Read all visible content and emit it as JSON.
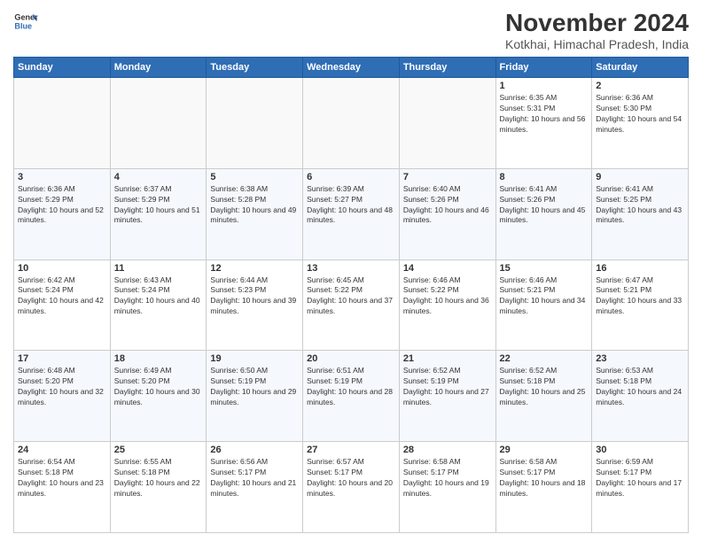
{
  "header": {
    "logo_line1": "General",
    "logo_line2": "Blue",
    "month_title": "November 2024",
    "subtitle": "Kotkhai, Himachal Pradesh, India"
  },
  "weekdays": [
    "Sunday",
    "Monday",
    "Tuesday",
    "Wednesday",
    "Thursday",
    "Friday",
    "Saturday"
  ],
  "weeks": [
    [
      {
        "day": "",
        "info": ""
      },
      {
        "day": "",
        "info": ""
      },
      {
        "day": "",
        "info": ""
      },
      {
        "day": "",
        "info": ""
      },
      {
        "day": "",
        "info": ""
      },
      {
        "day": "1",
        "info": "Sunrise: 6:35 AM\nSunset: 5:31 PM\nDaylight: 10 hours and 56 minutes."
      },
      {
        "day": "2",
        "info": "Sunrise: 6:36 AM\nSunset: 5:30 PM\nDaylight: 10 hours and 54 minutes."
      }
    ],
    [
      {
        "day": "3",
        "info": "Sunrise: 6:36 AM\nSunset: 5:29 PM\nDaylight: 10 hours and 52 minutes."
      },
      {
        "day": "4",
        "info": "Sunrise: 6:37 AM\nSunset: 5:29 PM\nDaylight: 10 hours and 51 minutes."
      },
      {
        "day": "5",
        "info": "Sunrise: 6:38 AM\nSunset: 5:28 PM\nDaylight: 10 hours and 49 minutes."
      },
      {
        "day": "6",
        "info": "Sunrise: 6:39 AM\nSunset: 5:27 PM\nDaylight: 10 hours and 48 minutes."
      },
      {
        "day": "7",
        "info": "Sunrise: 6:40 AM\nSunset: 5:26 PM\nDaylight: 10 hours and 46 minutes."
      },
      {
        "day": "8",
        "info": "Sunrise: 6:41 AM\nSunset: 5:26 PM\nDaylight: 10 hours and 45 minutes."
      },
      {
        "day": "9",
        "info": "Sunrise: 6:41 AM\nSunset: 5:25 PM\nDaylight: 10 hours and 43 minutes."
      }
    ],
    [
      {
        "day": "10",
        "info": "Sunrise: 6:42 AM\nSunset: 5:24 PM\nDaylight: 10 hours and 42 minutes."
      },
      {
        "day": "11",
        "info": "Sunrise: 6:43 AM\nSunset: 5:24 PM\nDaylight: 10 hours and 40 minutes."
      },
      {
        "day": "12",
        "info": "Sunrise: 6:44 AM\nSunset: 5:23 PM\nDaylight: 10 hours and 39 minutes."
      },
      {
        "day": "13",
        "info": "Sunrise: 6:45 AM\nSunset: 5:22 PM\nDaylight: 10 hours and 37 minutes."
      },
      {
        "day": "14",
        "info": "Sunrise: 6:46 AM\nSunset: 5:22 PM\nDaylight: 10 hours and 36 minutes."
      },
      {
        "day": "15",
        "info": "Sunrise: 6:46 AM\nSunset: 5:21 PM\nDaylight: 10 hours and 34 minutes."
      },
      {
        "day": "16",
        "info": "Sunrise: 6:47 AM\nSunset: 5:21 PM\nDaylight: 10 hours and 33 minutes."
      }
    ],
    [
      {
        "day": "17",
        "info": "Sunrise: 6:48 AM\nSunset: 5:20 PM\nDaylight: 10 hours and 32 minutes."
      },
      {
        "day": "18",
        "info": "Sunrise: 6:49 AM\nSunset: 5:20 PM\nDaylight: 10 hours and 30 minutes."
      },
      {
        "day": "19",
        "info": "Sunrise: 6:50 AM\nSunset: 5:19 PM\nDaylight: 10 hours and 29 minutes."
      },
      {
        "day": "20",
        "info": "Sunrise: 6:51 AM\nSunset: 5:19 PM\nDaylight: 10 hours and 28 minutes."
      },
      {
        "day": "21",
        "info": "Sunrise: 6:52 AM\nSunset: 5:19 PM\nDaylight: 10 hours and 27 minutes."
      },
      {
        "day": "22",
        "info": "Sunrise: 6:52 AM\nSunset: 5:18 PM\nDaylight: 10 hours and 25 minutes."
      },
      {
        "day": "23",
        "info": "Sunrise: 6:53 AM\nSunset: 5:18 PM\nDaylight: 10 hours and 24 minutes."
      }
    ],
    [
      {
        "day": "24",
        "info": "Sunrise: 6:54 AM\nSunset: 5:18 PM\nDaylight: 10 hours and 23 minutes."
      },
      {
        "day": "25",
        "info": "Sunrise: 6:55 AM\nSunset: 5:18 PM\nDaylight: 10 hours and 22 minutes."
      },
      {
        "day": "26",
        "info": "Sunrise: 6:56 AM\nSunset: 5:17 PM\nDaylight: 10 hours and 21 minutes."
      },
      {
        "day": "27",
        "info": "Sunrise: 6:57 AM\nSunset: 5:17 PM\nDaylight: 10 hours and 20 minutes."
      },
      {
        "day": "28",
        "info": "Sunrise: 6:58 AM\nSunset: 5:17 PM\nDaylight: 10 hours and 19 minutes."
      },
      {
        "day": "29",
        "info": "Sunrise: 6:58 AM\nSunset: 5:17 PM\nDaylight: 10 hours and 18 minutes."
      },
      {
        "day": "30",
        "info": "Sunrise: 6:59 AM\nSunset: 5:17 PM\nDaylight: 10 hours and 17 minutes."
      }
    ]
  ]
}
